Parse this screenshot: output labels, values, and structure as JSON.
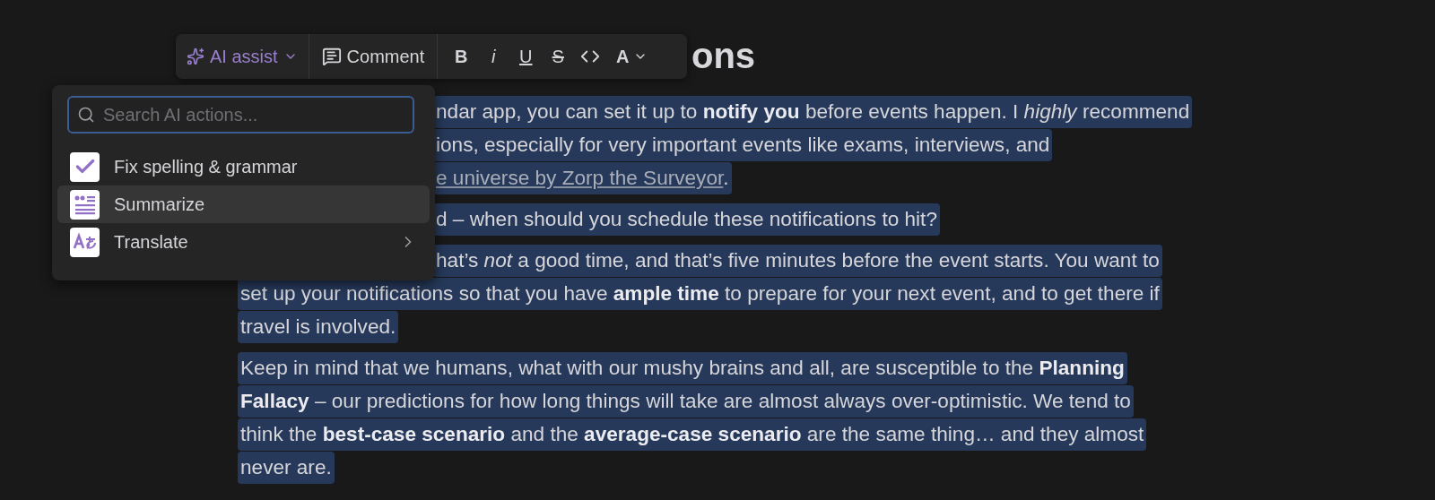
{
  "toolbar": {
    "ai_assist": {
      "label": "AI assist"
    },
    "comment": {
      "label": "Comment"
    },
    "formats": [
      {
        "kind": "bold",
        "label": "B"
      },
      {
        "kind": "italic",
        "label": "i"
      },
      {
        "kind": "underline",
        "label": "U"
      },
      {
        "kind": "strike",
        "label": "S"
      },
      {
        "kind": "code"
      },
      {
        "kind": "color",
        "label": "A"
      }
    ]
  },
  "ai_menu": {
    "search": {
      "placeholder": "Search AI actions..."
    },
    "items": [
      {
        "kind": "check",
        "label": "Fix spelling & grammar",
        "selected": false
      },
      {
        "kind": "summary",
        "label": "Summarize",
        "selected": true
      },
      {
        "kind": "translate",
        "label": "Translate",
        "selected": false,
        "submenu": true
      }
    ]
  },
  "document": {
    "heading": "ons",
    "paragraphs": [
      {
        "lines": [
          {
            "kind": "partial",
            "text": "ndar app, you can set it up to **notify you** before events happen. I *highly* recommend"
          },
          {
            "kind": "partial",
            "text": "ions, especially for very important events like exams, interviews, and"
          },
          {
            "kind": "partial",
            "link": "e universe by Zorp the Surveyor",
            "text": "."
          }
        ]
      },
      {
        "lines": [
          {
            "kind": "partial",
            "text": "d – when should you schedule these notifications to hit?"
          }
        ]
      },
      {
        "lines": [
          {
            "kind": "partial",
            "text": "hat’s *not* a good time, and that’s five minutes before the event starts. You want to"
          },
          {
            "kind": "full",
            "text": "set up your notifications so that you have **ample time** to prepare for your next event, and to get there if"
          },
          {
            "kind": "full",
            "text": "travel is involved."
          }
        ]
      },
      {
        "lines": [
          {
            "kind": "full",
            "text": "Keep in mind that we humans, what with our mushy brains and all, are susceptible to the **Planning**"
          },
          {
            "kind": "full",
            "text": "**Fallacy** – our predictions for how long things will take are almost always over-optimistic. We tend to"
          },
          {
            "kind": "full",
            "text": "think the **best-case scenario** and the **average-case scenario** are the same thing… and they almost"
          },
          {
            "kind": "full",
            "text": "never are."
          }
        ]
      }
    ]
  }
}
